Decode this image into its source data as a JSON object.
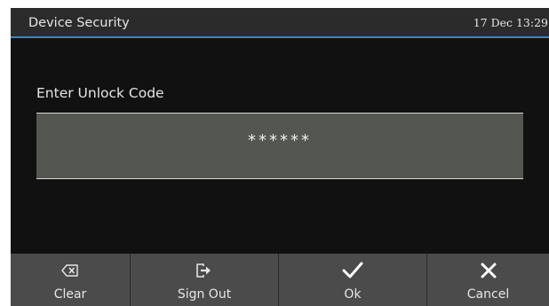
{
  "header": {
    "title": "Device Security",
    "datetime": "17 Dec 13:29"
  },
  "unlock": {
    "prompt": "Enter Unlock Code",
    "masked_value": "******"
  },
  "softkeys": [
    {
      "label": "Clear",
      "icon": "backspace-icon"
    },
    {
      "label": "Sign Out",
      "icon": "sign-out-icon"
    },
    {
      "label": "Ok",
      "icon": "checkmark-icon"
    },
    {
      "label": "Cancel",
      "icon": "close-icon"
    }
  ],
  "colors": {
    "screen_background": "#111111",
    "status_bar": "#2b2b2b",
    "accent_line": "#3a86c8",
    "input_field": "#545650",
    "softkey_bar": "#4b4b4b",
    "text": "#e6e6e6"
  }
}
